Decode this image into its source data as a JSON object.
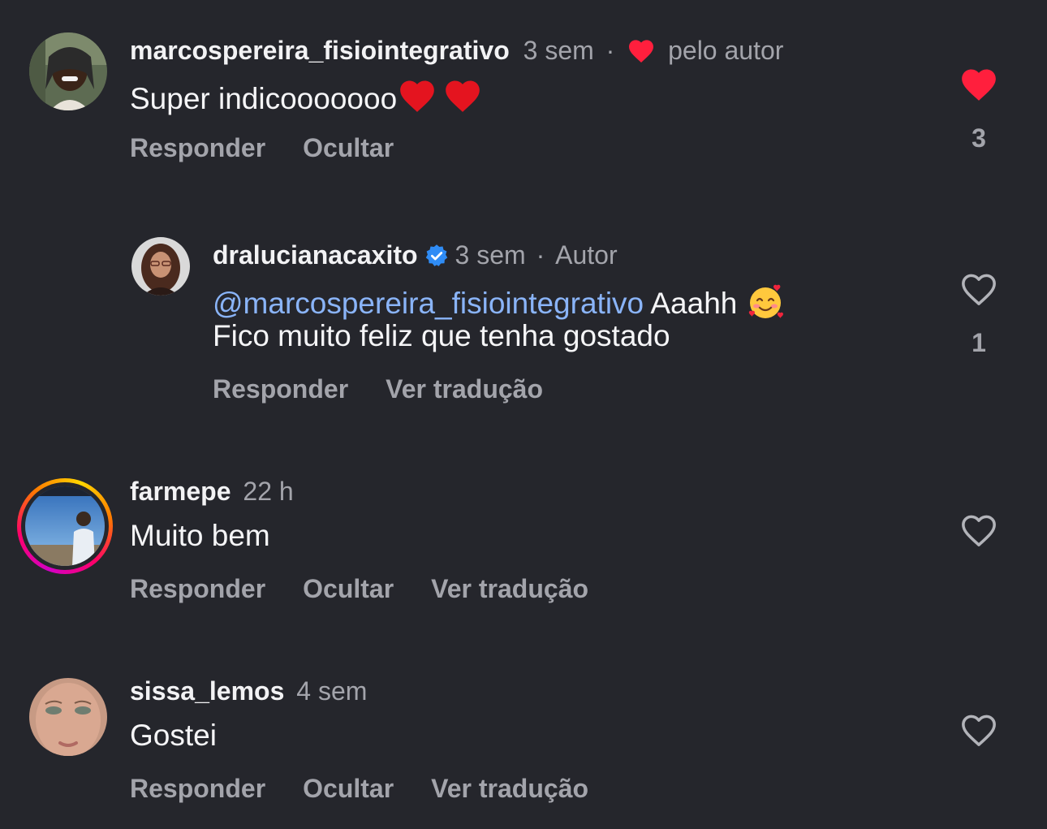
{
  "comments": [
    {
      "username": "marcospereira_fisiointegrativo",
      "time": "3 sem",
      "separator": "·",
      "badge_text": "pelo autor",
      "text": "Super indicooooooo",
      "emoji": "♥♥",
      "actions": [
        "Responder",
        "Ocultar"
      ],
      "likes": "3",
      "liked": true
    },
    {
      "username": "dralucianacaxito",
      "verified": true,
      "time": "3 sem",
      "separator": "·",
      "role": "Autor",
      "mention": "@marcospereira_fisiointegrativo",
      "text_line1": " Aaahh",
      "text_line2": "Fico muito feliz que tenha gostado",
      "actions": [
        "Responder",
        "Ver tradução"
      ],
      "likes": "1",
      "liked": false
    },
    {
      "username": "farmepe",
      "time": "22 h",
      "text": "Muito bem",
      "actions": [
        "Responder",
        "Ocultar",
        "Ver tradução"
      ],
      "liked": false,
      "has_story_ring": true
    },
    {
      "username": "sissa_lemos",
      "time": "4 sem",
      "text": "Gostei",
      "actions": [
        "Responder",
        "Ocultar",
        "Ver tradução"
      ],
      "liked": false
    }
  ],
  "colors": {
    "background": "#25262c",
    "text": "#f5f5f7",
    "secondary": "#a3a4ab",
    "mention": "#8ab4f8",
    "heart": "#ff1f3d",
    "verified": "#2f8cf5"
  }
}
